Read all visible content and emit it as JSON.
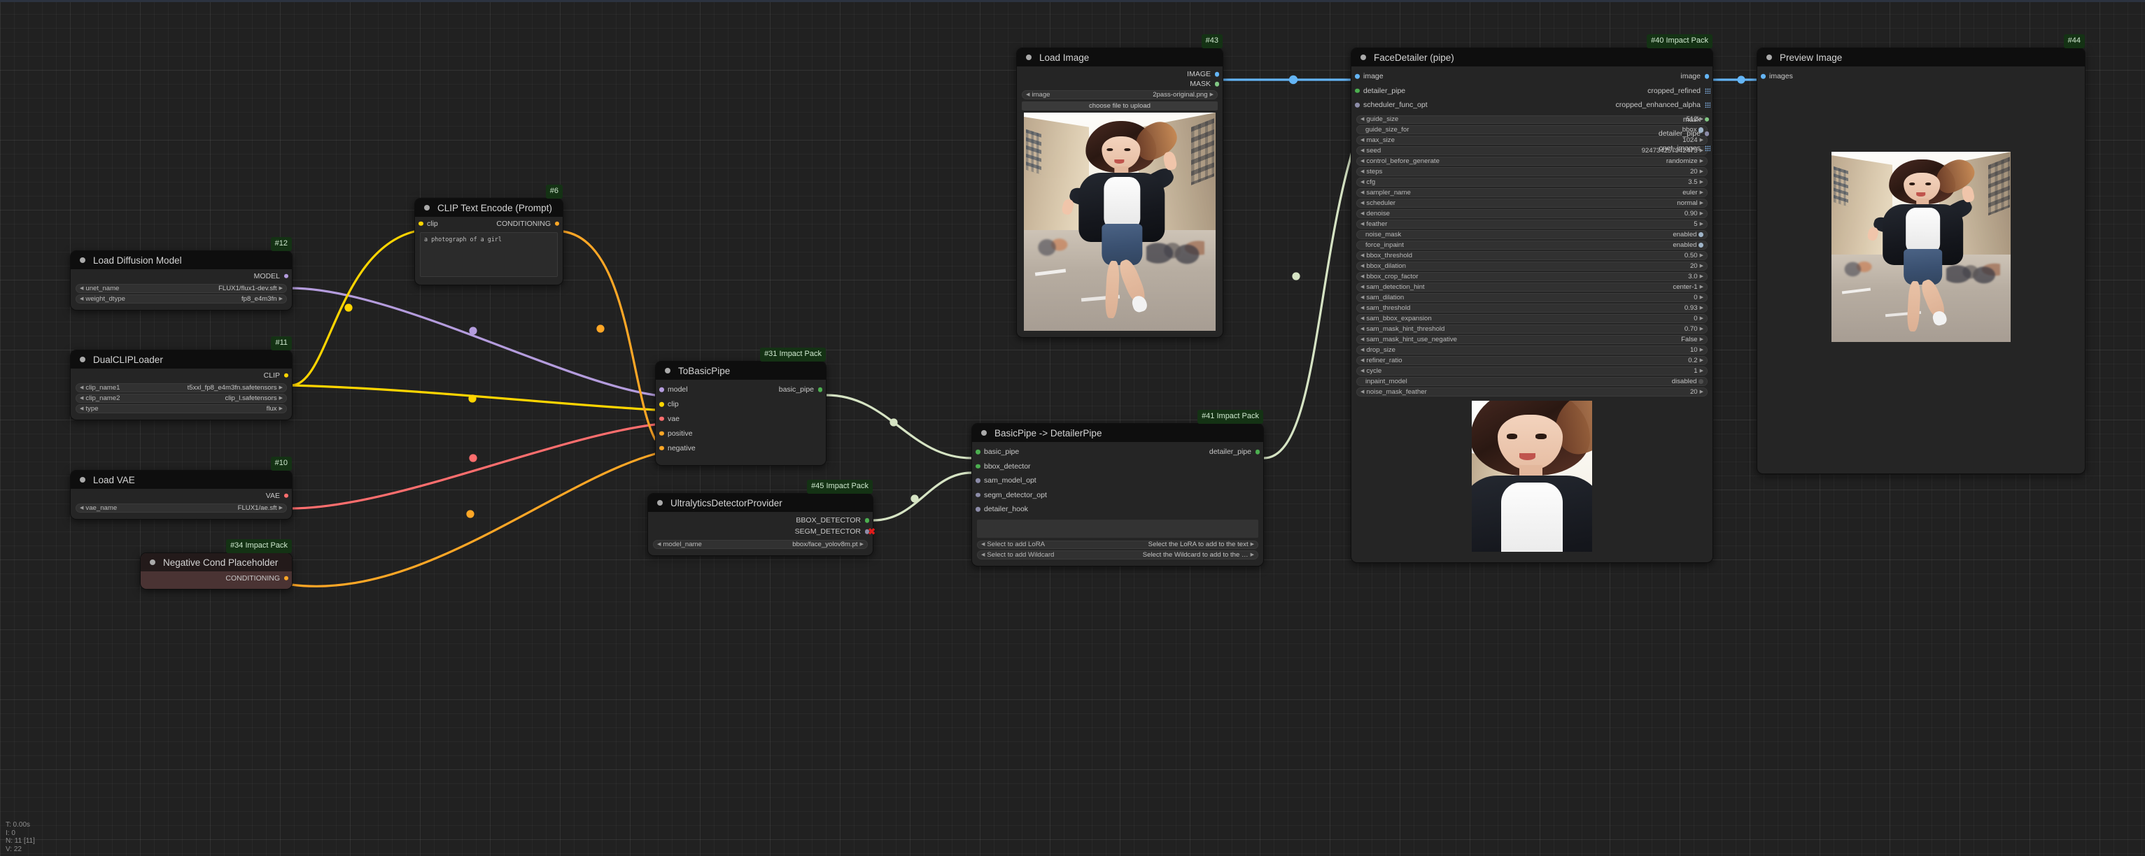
{
  "app": {
    "canvas_bg": "#212121",
    "status_lines": [
      "T: 0.00s",
      "I: 0",
      "N: 11 [11]",
      "V: 22"
    ]
  },
  "link_colors": {
    "MODEL": "#b49cdd",
    "CLIP": "#ffd500",
    "VAE": "#ff6e6e",
    "CONDITIONING": "#ffa726",
    "IMAGE": "#64b5f6",
    "MASK": "#81c784",
    "BASIC_PIPE": "#d6e4c4",
    "DETAILER_PIPE": "#d6e4c4",
    "BBOX_DETECTOR": "#4caf50",
    "OPTIONAL": "#8c8ca8"
  },
  "nodes": [
    {
      "id": "load-diffusion-model",
      "badge": "#12",
      "title": "Load Diffusion Model",
      "outputs": [
        {
          "label": "MODEL",
          "color": "#b49cdd"
        }
      ],
      "widgets": [
        {
          "name": "unet_name",
          "value": "FLUX1/flux1-dev.sft",
          "type": "combo"
        },
        {
          "name": "weight_dtype",
          "value": "fp8_e4m3fn",
          "type": "combo"
        }
      ]
    },
    {
      "id": "dualcliploader",
      "badge": "#11",
      "title": "DualCLIPLoader",
      "outputs": [
        {
          "label": "CLIP",
          "color": "#ffd500"
        }
      ],
      "widgets": [
        {
          "name": "clip_name1",
          "value": "t5xxl_fp8_e4m3fn.safetensors",
          "type": "combo"
        },
        {
          "name": "clip_name2",
          "value": "clip_l.safetensors",
          "type": "combo"
        },
        {
          "name": "type",
          "value": "flux",
          "type": "combo"
        }
      ]
    },
    {
      "id": "load-vae",
      "badge": "#10",
      "title": "Load VAE",
      "outputs": [
        {
          "label": "VAE",
          "color": "#ff6e6e"
        }
      ],
      "widgets": [
        {
          "name": "vae_name",
          "value": "FLUX1/ae.sft",
          "type": "combo"
        }
      ]
    },
    {
      "id": "negative-cond-placeholder",
      "badge": "#34 Impact Pack",
      "title": "Negative Cond Placeholder",
      "outputs": [
        {
          "label": "CONDITIONING",
          "color": "#ffa726"
        }
      ],
      "widgets": []
    },
    {
      "id": "clip-text-encode",
      "badge": "#6",
      "title": "CLIP Text Encode (Prompt)",
      "inputs": [
        {
          "label": "clip",
          "color": "#ffd500"
        }
      ],
      "outputs": [
        {
          "label": "CONDITIONING",
          "color": "#ffa726"
        }
      ],
      "text_value": "a photograph of a girl"
    },
    {
      "id": "tobasicpipe",
      "badge": "#31 Impact Pack",
      "title": "ToBasicPipe",
      "inputs": [
        {
          "label": "model",
          "color": "#b49cdd"
        },
        {
          "label": "clip",
          "color": "#ffd500"
        },
        {
          "label": "vae",
          "color": "#ff6e6e"
        },
        {
          "label": "positive",
          "color": "#ffa726"
        },
        {
          "label": "negative",
          "color": "#ffa726"
        }
      ],
      "outputs": [
        {
          "label": "basic_pipe",
          "color": "#4caf50"
        }
      ]
    },
    {
      "id": "ultralytics-detector-provider",
      "badge": "#45 Impact Pack",
      "title": "UltralyticsDetectorProvider",
      "outputs": [
        {
          "label": "BBOX_DETECTOR",
          "color": "#4caf50"
        },
        {
          "label": "SEGM_DETECTOR",
          "color": "#8c8ca8",
          "error": true
        }
      ],
      "widgets": [
        {
          "name": "model_name",
          "value": "bbox/face_yolov8m.pt",
          "type": "combo"
        }
      ]
    },
    {
      "id": "load-image",
      "badge": "#43",
      "title": "Load Image",
      "outputs": [
        {
          "label": "IMAGE",
          "color": "#64b5f6"
        },
        {
          "label": "MASK",
          "color": "#81c784"
        }
      ],
      "widgets": [
        {
          "name": "image",
          "value": "2pass-original.png",
          "type": "combo"
        }
      ],
      "button": "choose file to upload"
    },
    {
      "id": "basicpipe-to-detailerpipe",
      "badge": "#41 Impact Pack",
      "title": "BasicPipe -> DetailerPipe",
      "inputs": [
        {
          "label": "basic_pipe",
          "color": "#4caf50"
        },
        {
          "label": "bbox_detector",
          "color": "#4caf50"
        },
        {
          "label": "sam_model_opt",
          "color": "#8c8ca8"
        },
        {
          "label": "segm_detector_opt",
          "color": "#8c8ca8"
        },
        {
          "label": "detailer_hook",
          "color": "#8c8ca8"
        }
      ],
      "outputs": [
        {
          "label": "detailer_pipe",
          "color": "#4caf50"
        }
      ],
      "widgets": [
        {
          "name": "Select to add LoRA",
          "value": "Select the LoRA to add to the text",
          "type": "combo"
        },
        {
          "name": "Select to add Wildcard",
          "value": "Select the Wildcard to add to the …",
          "type": "combo"
        }
      ]
    },
    {
      "id": "facedetailer-pipe",
      "badge": "#40 Impact Pack",
      "title": "FaceDetailer (pipe)",
      "inputs": [
        {
          "label": "image",
          "color": "#64b5f6"
        },
        {
          "label": "detailer_pipe",
          "color": "#4caf50"
        },
        {
          "label": "scheduler_func_opt",
          "color": "#8c8ca8"
        }
      ],
      "outputs": [
        {
          "label": "image",
          "color": "#64b5f6"
        },
        {
          "label": "cropped_refined",
          "color": "#7aa7d8",
          "grid": true
        },
        {
          "label": "cropped_enhanced_alpha",
          "color": "#7aa7d8",
          "grid": true
        },
        {
          "label": "mask",
          "color": "#81c784"
        },
        {
          "label": "detailer_pipe",
          "color": "#8c8ca8"
        },
        {
          "label": "cnet_images",
          "color": "#7aa7d8",
          "grid": true
        }
      ],
      "widgets": [
        {
          "name": "guide_size",
          "value": "512",
          "type": "number"
        },
        {
          "name": "guide_size_for",
          "value": "bbox",
          "type": "toggle",
          "on": true
        },
        {
          "name": "max_size",
          "value": "1024",
          "type": "number"
        },
        {
          "name": "seed",
          "value": "924734257942473",
          "type": "number"
        },
        {
          "name": "control_before_generate",
          "value": "randomize",
          "type": "combo"
        },
        {
          "name": "steps",
          "value": "20",
          "type": "number"
        },
        {
          "name": "cfg",
          "value": "3.5",
          "type": "number"
        },
        {
          "name": "sampler_name",
          "value": "euler",
          "type": "combo"
        },
        {
          "name": "scheduler",
          "value": "normal",
          "type": "combo"
        },
        {
          "name": "denoise",
          "value": "0.90",
          "type": "number"
        },
        {
          "name": "feather",
          "value": "5",
          "type": "number"
        },
        {
          "name": "noise_mask",
          "value": "enabled",
          "type": "toggle",
          "on": true
        },
        {
          "name": "force_inpaint",
          "value": "enabled",
          "type": "toggle",
          "on": true
        },
        {
          "name": "bbox_threshold",
          "value": "0.50",
          "type": "number"
        },
        {
          "name": "bbox_dilation",
          "value": "20",
          "type": "number"
        },
        {
          "name": "bbox_crop_factor",
          "value": "3.0",
          "type": "number"
        },
        {
          "name": "sam_detection_hint",
          "value": "center-1",
          "type": "combo"
        },
        {
          "name": "sam_dilation",
          "value": "0",
          "type": "number"
        },
        {
          "name": "sam_threshold",
          "value": "0.93",
          "type": "number"
        },
        {
          "name": "sam_bbox_expansion",
          "value": "0",
          "type": "number"
        },
        {
          "name": "sam_mask_hint_threshold",
          "value": "0.70",
          "type": "number"
        },
        {
          "name": "sam_mask_hint_use_negative",
          "value": "False",
          "type": "combo"
        },
        {
          "name": "drop_size",
          "value": "10",
          "type": "number"
        },
        {
          "name": "refiner_ratio",
          "value": "0.2",
          "type": "number"
        },
        {
          "name": "cycle",
          "value": "1",
          "type": "number"
        },
        {
          "name": "inpaint_model",
          "value": "disabled",
          "type": "toggle",
          "on": false
        },
        {
          "name": "noise_mask_feather",
          "value": "20",
          "type": "number"
        }
      ]
    },
    {
      "id": "preview-image",
      "badge": "#44",
      "title": "Preview Image",
      "inputs": [
        {
          "label": "images",
          "color": "#64b5f6"
        }
      ]
    }
  ]
}
